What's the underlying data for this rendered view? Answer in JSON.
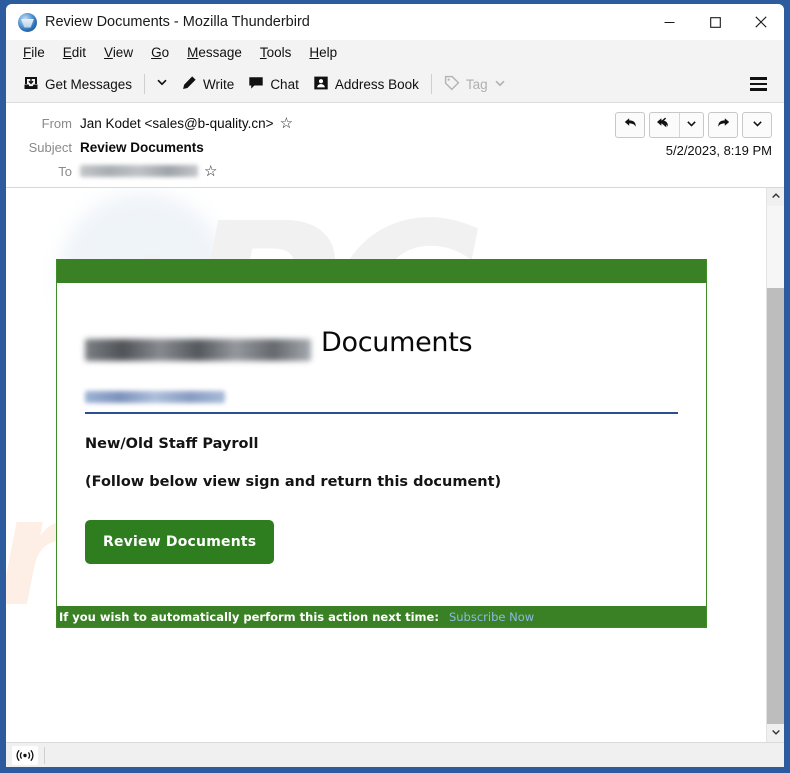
{
  "window": {
    "title": "Review Documents - Mozilla Thunderbird",
    "app_logo_icon": "thunderbird-logo-icon",
    "controls": {
      "minimize": "minimize-icon",
      "maximize": "maximize-icon",
      "close": "close-icon"
    }
  },
  "menubar": {
    "items": [
      {
        "mnemonic": "F",
        "rest": "ile"
      },
      {
        "mnemonic": "E",
        "rest": "dit"
      },
      {
        "mnemonic": "V",
        "rest": "iew"
      },
      {
        "mnemonic": "G",
        "rest": "o"
      },
      {
        "mnemonic": "M",
        "rest": "essage"
      },
      {
        "mnemonic": "T",
        "rest": "ools"
      },
      {
        "mnemonic": "H",
        "rest": "elp"
      }
    ]
  },
  "toolbar": {
    "get_messages": "Get Messages",
    "get_messages_icon": "download-inbox-icon",
    "get_messages_chevron_icon": "chevron-down-icon",
    "write": "Write",
    "write_icon": "pencil-icon",
    "chat": "Chat",
    "chat_icon": "speech-bubble-icon",
    "address_book": "Address Book",
    "address_book_icon": "contact-card-icon",
    "tag": "Tag",
    "tag_icon": "tag-icon",
    "tag_chevron_icon": "chevron-down-icon",
    "app_menu_icon": "hamburger-menu-icon"
  },
  "message_header": {
    "from_label": "From",
    "from_value": "Jan Kodet <sales@b-quality.cn>",
    "from_star_icon": "star-icon",
    "subject_label": "Subject",
    "subject_value": "Review Documents",
    "to_label": "To",
    "to_value_redacted": "",
    "to_star_icon": "star-icon",
    "date": "5/2/2023, 8:19 PM",
    "actions": {
      "reply_icon": "reply-icon",
      "reply_all_icon": "reply-all-icon",
      "reply_all_chevron_icon": "chevron-down-icon",
      "forward_icon": "forward-icon",
      "more_chevron_icon": "chevron-down-icon"
    }
  },
  "email_body": {
    "watermark_primary": "PC",
    "watermark_secondary": "risk.com",
    "brand_redacted": "",
    "brand_title": "Documents",
    "sub_redacted": "",
    "line1": "New/Old Staff Payroll",
    "line2": "(Follow below view sign and return this document)",
    "cta_label": "Review Documents",
    "footer_text": "If you wish to automatically perform this action next time:",
    "footer_link": "Subscribe Now",
    "colors": {
      "header_green": "#3a8024",
      "button_green": "#2e7d1f",
      "rule_blue": "#2c4f8f",
      "footer_link_blue": "#8fb8e6",
      "window_frame_blue": "#2d5c9e"
    }
  },
  "scrollbar": {
    "up_arrow_icon": "chevron-up-icon",
    "down_arrow_icon": "chevron-down-icon"
  },
  "statusbar": {
    "connection_icon": "broadcast-icon"
  }
}
